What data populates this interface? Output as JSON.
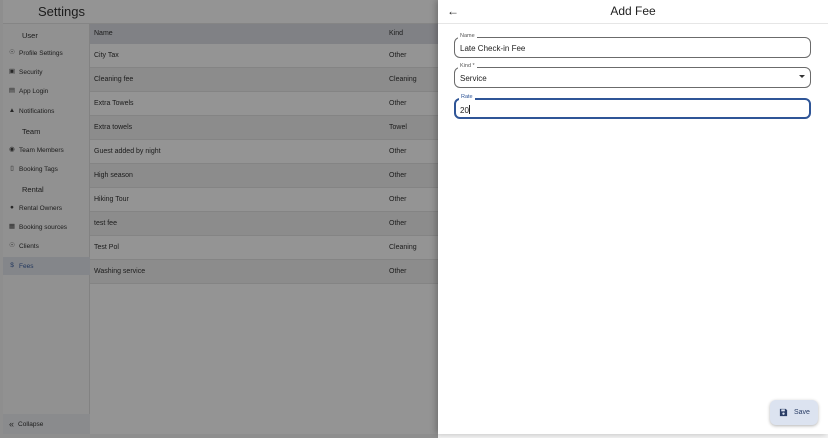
{
  "app": {
    "title": "Settings"
  },
  "sidebar": {
    "sections": [
      {
        "header": "User",
        "items": [
          {
            "label": "Profile Settings",
            "icon": "account-circle-icon"
          },
          {
            "label": "Security",
            "icon": "lock-icon"
          },
          {
            "label": "App Login",
            "icon": "login-icon"
          },
          {
            "label": "Notifications",
            "icon": "bell-icon"
          }
        ]
      },
      {
        "header": "Team",
        "items": [
          {
            "label": "Team Members",
            "icon": "team-icon"
          },
          {
            "label": "Booking Tags",
            "icon": "bookmark-icon"
          }
        ]
      },
      {
        "header": "Rental",
        "items": [
          {
            "label": "Rental Owners",
            "icon": "people-icon"
          },
          {
            "label": "Booking sources",
            "icon": "store-icon"
          },
          {
            "label": "Clients",
            "icon": "person-circle-icon"
          },
          {
            "label": "Fees",
            "icon": "dollar-icon",
            "active": true
          }
        ]
      }
    ],
    "collapse_label": "Collapse"
  },
  "table": {
    "columns": [
      "Name",
      "Kind"
    ],
    "rows": [
      {
        "name": "City Tax",
        "kind": "Other"
      },
      {
        "name": "Cleaning fee",
        "kind": "Cleaning"
      },
      {
        "name": "Extra Towels",
        "kind": "Other"
      },
      {
        "name": "Extra towels",
        "kind": "Towel"
      },
      {
        "name": "Guest added by night",
        "kind": "Other"
      },
      {
        "name": "High season",
        "kind": "Other"
      },
      {
        "name": "Hiking Tour",
        "kind": "Other"
      },
      {
        "name": "test fee",
        "kind": "Other"
      },
      {
        "name": "Test Pol",
        "kind": "Cleaning"
      },
      {
        "name": "Washing service",
        "kind": "Other"
      }
    ]
  },
  "drawer": {
    "title": "Add Fee",
    "back_icon": "arrow-left-icon",
    "fields": {
      "name": {
        "label": "Name",
        "value": "Late Check-in Fee"
      },
      "kind": {
        "label": "Kind *",
        "value": "Service"
      },
      "rate": {
        "label": "Rate",
        "value": "20"
      }
    },
    "save_label": "Save",
    "save_icon": "floppy-disk-icon"
  },
  "colors": {
    "accent": "#2f5597",
    "active_nav_bg": "#e3e7ee",
    "save_bg": "#dce3f0"
  }
}
